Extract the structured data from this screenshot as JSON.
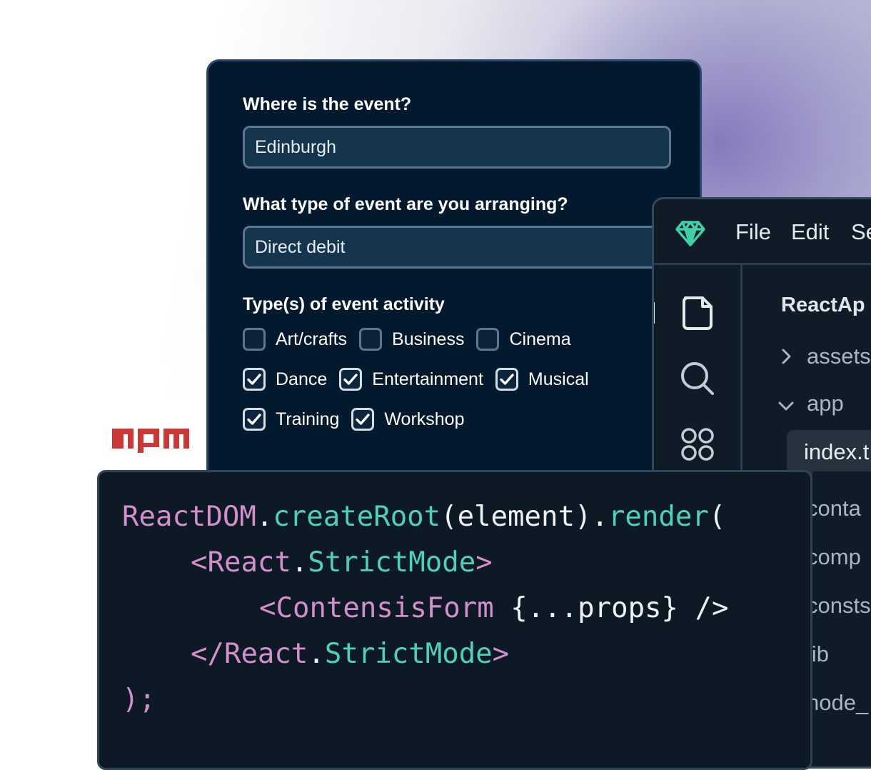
{
  "form": {
    "location_label": "Where is the event?",
    "location_value": "Edinburgh",
    "type_label": "What type of event are you arranging?",
    "type_value": "Direct debit",
    "activity_label": "Type(s) of event activity",
    "activities": [
      {
        "label": "Art/crafts",
        "checked": false
      },
      {
        "label": "Business",
        "checked": false
      },
      {
        "label": "Cinema",
        "checked": false
      },
      {
        "label": "Dance",
        "checked": true
      },
      {
        "label": "Entertainment",
        "checked": true
      },
      {
        "label": "Musical",
        "checked": true
      },
      {
        "label": "Training",
        "checked": true
      },
      {
        "label": "Workshop",
        "checked": true
      }
    ]
  },
  "npm": {
    "logo_text": "npm",
    "color": "#cb3837"
  },
  "editor": {
    "menu": [
      "File",
      "Edit",
      "Se"
    ],
    "explorer_title": "ReactAp",
    "tree": {
      "assets": "assets",
      "app": "app",
      "selected_file": "index.t",
      "below": [
        "conta",
        "comp",
        "consts",
        "lib",
        "node_"
      ]
    },
    "icons": [
      "gem-icon",
      "files-icon",
      "search-icon",
      "extensions-icon"
    ]
  },
  "code": {
    "line1": {
      "a": "ReactDOM",
      "b": ".",
      "c": "createRoot",
      "d": "(element).",
      "e": "render",
      "f": "("
    },
    "line2": {
      "a": "<React",
      "b": ".",
      "c": "StrictMode",
      "d": ">"
    },
    "line3": {
      "a": "<ContensisForm",
      "b": " {...props} ",
      "c": "/>"
    },
    "line4": {
      "a": "</React",
      "b": ".",
      "c": "StrictMode",
      "d": ">"
    },
    "line5": {
      "a": ");"
    }
  },
  "colors": {
    "form_bg": "#03192e",
    "code_bg": "#0d1a26",
    "accent_teal": "#4fd1b6",
    "accent_pink": "#d28fc9"
  }
}
